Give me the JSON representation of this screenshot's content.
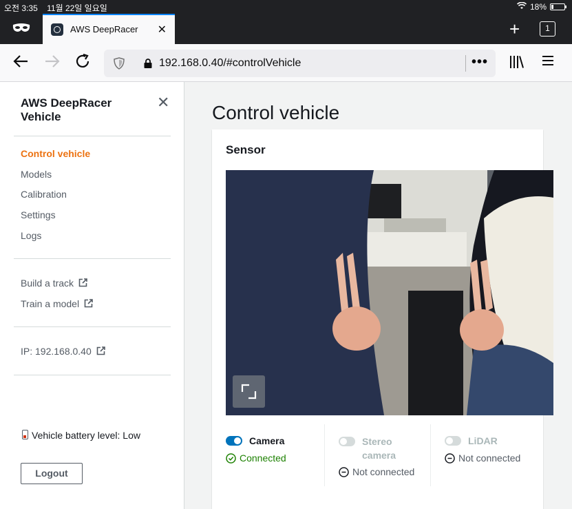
{
  "status_bar": {
    "time": "오전 3:35",
    "date": "11월 22일 일요일",
    "battery": "18%",
    "battery_level": 0.18
  },
  "browser": {
    "tab_title": "AWS DeepRacer",
    "tab_count": "1",
    "url": "192.168.0.40/#controlVehicle"
  },
  "sidebar": {
    "title": "AWS DeepRacer Vehicle",
    "nav": [
      {
        "label": "Control vehicle",
        "active": true
      },
      {
        "label": "Models"
      },
      {
        "label": "Calibration"
      },
      {
        "label": "Settings"
      },
      {
        "label": "Logs"
      }
    ],
    "links": [
      {
        "label": "Build a track"
      },
      {
        "label": "Train a model"
      }
    ],
    "ip": "IP: 192.168.0.40",
    "battery": "Vehicle battery level: Low",
    "logout": "Logout"
  },
  "main": {
    "title": "Control vehicle",
    "sensor_heading": "Sensor",
    "sensors": [
      {
        "name": "Camera",
        "enabled": true,
        "status": "Connected"
      },
      {
        "name": "Stereo camera",
        "enabled": false,
        "status": "Not connected"
      },
      {
        "name": "LiDAR",
        "enabled": false,
        "status": "Not connected"
      }
    ]
  },
  "colors": {
    "accent": "#ec7211",
    "toggle_on": "#0073bb",
    "connected": "#1d8102"
  }
}
